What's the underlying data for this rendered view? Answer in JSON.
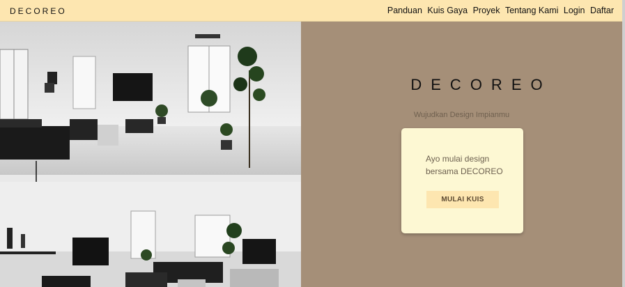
{
  "navbar": {
    "logo": "DECOREO",
    "links": [
      "Panduan",
      "Kuis Gaya",
      "Proyek",
      "Tentang Kami",
      "Login",
      "Daftar"
    ]
  },
  "hero": {
    "title": "DECOREO",
    "subtitle": "Wujudkan Design Impianmu",
    "card_text_line1": "Ayo mulai design",
    "card_text_line2": "bersama DECOREO",
    "cta_label": "MULAI KUIS"
  },
  "colors": {
    "navbar_bg": "#fde6b0",
    "hero_bg": "#a58f78",
    "card_bg": "#fdf8d3",
    "button_bg": "#fde6b0"
  }
}
